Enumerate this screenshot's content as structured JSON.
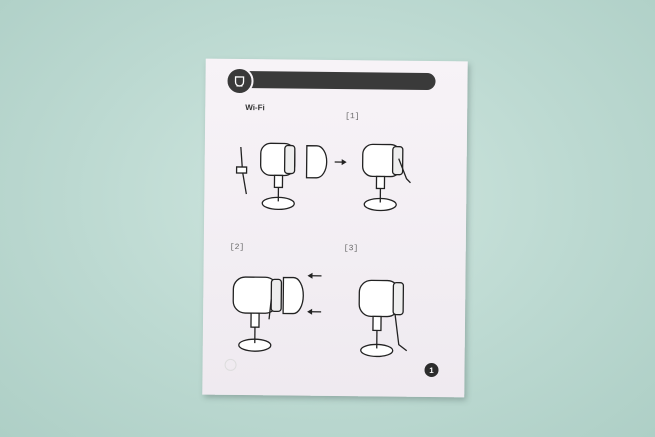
{
  "manual": {
    "title": "Wi-Fi",
    "steps": [
      "1",
      "2",
      "3"
    ],
    "page_number": "1"
  },
  "icons": [
    "camera-head-icon",
    "mount-icon",
    "arrow-icon"
  ],
  "colors": {
    "background": "#bcd9d1",
    "paper": "#f4f0f4",
    "header": "#3a3a3a"
  }
}
